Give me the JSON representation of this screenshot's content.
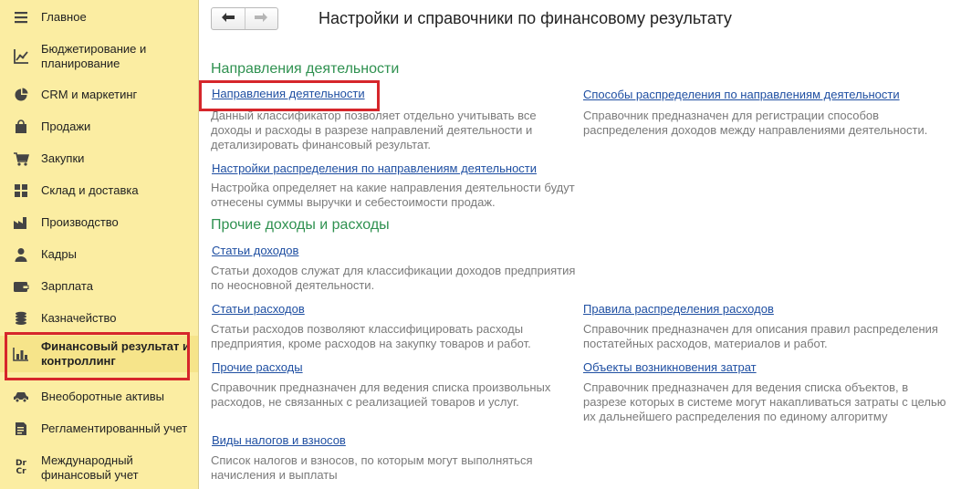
{
  "sidebar": {
    "items": [
      {
        "label": "Главное",
        "icon": "menu-icon"
      },
      {
        "label": "Бюджетирование и планирование",
        "icon": "budget-chart-icon"
      },
      {
        "label": "CRM и маркетинг",
        "icon": "pie-chart-icon"
      },
      {
        "label": "Продажи",
        "icon": "shopping-bag-icon"
      },
      {
        "label": "Закупки",
        "icon": "shopping-cart-icon"
      },
      {
        "label": "Склад и доставка",
        "icon": "warehouse-grid-icon"
      },
      {
        "label": "Производство",
        "icon": "factory-icon"
      },
      {
        "label": "Кадры",
        "icon": "person-icon"
      },
      {
        "label": "Зарплата",
        "icon": "wallet-icon"
      },
      {
        "label": "Казначейство",
        "icon": "coins-icon"
      },
      {
        "label": "Финансовый результат и контроллинг",
        "icon": "bar-chart-icon"
      },
      {
        "label": "Внеоборотные активы",
        "icon": "car-icon"
      },
      {
        "label": "Регламентированный учет",
        "icon": "document-icon"
      },
      {
        "label": "Международный финансовый учет",
        "icon": "dr-cr-icon",
        "icon_text": "Dr\nCr"
      }
    ],
    "active_index": 10
  },
  "toolbar": {
    "back_icon": "arrow-left-icon",
    "forward_icon": "arrow-right-icon"
  },
  "page": {
    "title": "Настройки и справочники по финансовому результату",
    "sections": [
      {
        "title": "Направления деятельности",
        "left": [
          {
            "link": "Направления деятельности",
            "description": "Данный классификатор позволяет отдельно учитывать все доходы и расходы в разрезе направлений деятельности и детализировать финансовый результат."
          },
          {
            "link": "Настройки распределения по направлениям деятельности",
            "description": "Настройка определяет на какие направления деятельности будут отнесены суммы выручки и себестоимости продаж."
          }
        ],
        "right": [
          {
            "link": "Способы распределения по направлениям деятельности",
            "description": "Справочник предназначен для регистрации способов распределения доходов между направлениями деятельности."
          }
        ]
      },
      {
        "title": "Прочие доходы и расходы",
        "left": [
          {
            "link": "Статьи доходов",
            "description": "Статьи доходов служат для классификации доходов предприятия по неосновной деятельности."
          },
          {
            "link": "Статьи расходов",
            "description": "Статьи расходов позволяют классифицировать расходы предприятия, кроме расходов на закупку товаров и работ."
          },
          {
            "link": "Прочие расходы",
            "description": "Справочник предназначен для ведения списка произвольных расходов, не связанных с реализацией товаров и услуг."
          },
          {
            "link": "Виды налогов и взносов",
            "description": "Список налогов и взносов, по которым могут выполняться начисления и выплаты"
          }
        ],
        "right": [
          {
            "link": "Правила распределения расходов",
            "description": "Справочник предназначен для описания правил распределения постатейных расходов, материалов и работ."
          },
          {
            "link": "Объекты возникновения затрат",
            "description": "Справочник предназначен для ведения списка объектов, в разрезе которых в системе могут накапливаться затраты с целью их дальнейшего распределения по единому алгоритму"
          }
        ]
      }
    ]
  },
  "colors": {
    "sidebar_bg": "#fbeda2",
    "section_title": "#2f9150",
    "link": "#1f4fa2",
    "description": "#7a7a7a",
    "highlight_frame": "#d6262b"
  }
}
